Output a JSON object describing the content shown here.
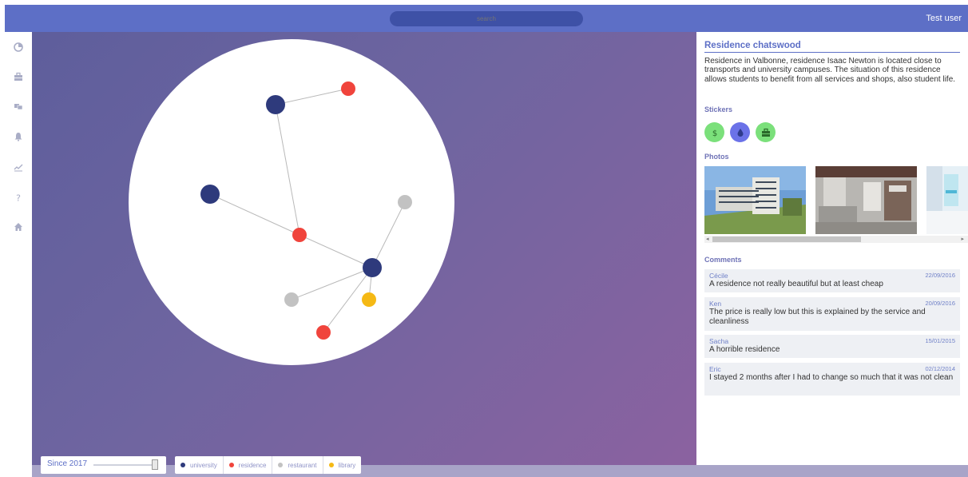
{
  "topbar": {
    "search_placeholder": "search",
    "user_label": "Test user",
    "color": "#5d6fc6"
  },
  "sidebar": {
    "items": [
      {
        "icon": "globe-icon"
      },
      {
        "icon": "briefcase-icon"
      },
      {
        "icon": "folders-icon"
      },
      {
        "icon": "bell-icon"
      },
      {
        "icon": "chart-line-icon"
      },
      {
        "icon": "help-icon"
      },
      {
        "icon": "home-icon"
      }
    ]
  },
  "graph": {
    "nodes": [
      {
        "id": "n1",
        "type": "university"
      },
      {
        "id": "n2",
        "type": "residence"
      },
      {
        "id": "n3",
        "type": "university"
      },
      {
        "id": "n4",
        "type": "residence"
      },
      {
        "id": "n5",
        "type": "restaurant"
      },
      {
        "id": "n6",
        "type": "university"
      },
      {
        "id": "n7",
        "type": "restaurant"
      },
      {
        "id": "n8",
        "type": "library"
      },
      {
        "id": "n9",
        "type": "residence"
      }
    ],
    "edges": [
      [
        "n1",
        "n2"
      ],
      [
        "n1",
        "n4"
      ],
      [
        "n3",
        "n4"
      ],
      [
        "n4",
        "n6"
      ],
      [
        "n5",
        "n6"
      ],
      [
        "n6",
        "n7"
      ],
      [
        "n6",
        "n8"
      ],
      [
        "n6",
        "n9"
      ]
    ],
    "type_colors": {
      "university": "#2e3a7c",
      "residence": "#f0443c",
      "restaurant": "#c2c2c2",
      "library": "#f5b915"
    }
  },
  "controls": {
    "since_label": "Since 2017",
    "legend": [
      {
        "label": "university",
        "color": "#2e3a7c"
      },
      {
        "label": "residence",
        "color": "#f0443c"
      },
      {
        "label": "restaurant",
        "color": "#c2c2c2"
      },
      {
        "label": "library",
        "color": "#f5b915"
      }
    ]
  },
  "panel": {
    "title": "Residence chatswood",
    "description": "Residence in Valbonne, residence Isaac Newton is located close to transports and university campuses. The situation of this residence allows students to benefit from all services and shops, also student life.",
    "stickers_heading": "Stickers",
    "stickers": [
      {
        "icon": "dollar-icon",
        "color": "#7be07b"
      },
      {
        "icon": "drop-icon",
        "color": "#6b72e8"
      },
      {
        "icon": "briefcase-icon",
        "color": "#7be07b"
      }
    ],
    "photos_heading": "Photos",
    "comments_heading": "Comments",
    "comments": [
      {
        "author": "Cécile",
        "date": "22/09/2016",
        "text": "A residence not really beautiful but at least cheap"
      },
      {
        "author": "Ken",
        "date": "20/09/2016",
        "text": "The price is really low but this is explained by the service and cleanliness"
      },
      {
        "author": "Sacha",
        "date": "15/01/2015",
        "text": "A horrible residence"
      },
      {
        "author": "Eric",
        "date": "02/12/2014",
        "text": "I stayed 2 months after I had to change so much that it was not clean"
      }
    ]
  }
}
